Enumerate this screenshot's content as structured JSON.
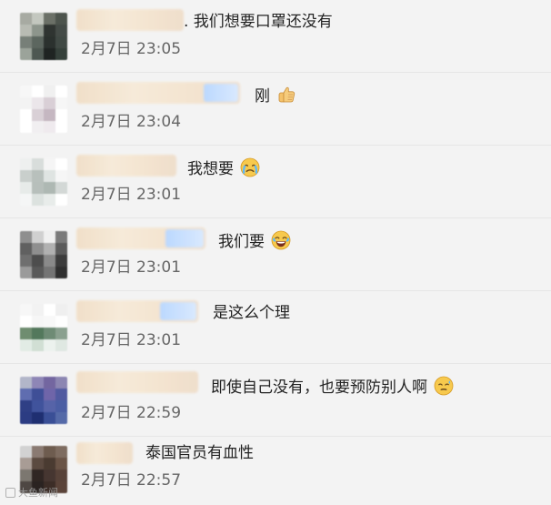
{
  "comments": [
    {
      "text": ". 我们想要口罩还没有",
      "time": "2月7日 23:05",
      "avatar_palette": [
        "#a7aaa2",
        "#c3c7bf",
        "#6b7067",
        "#4d544d",
        "#b8bbb3",
        "#8d958c",
        "#2f3431",
        "#444b47",
        "#777f78",
        "#5c665f",
        "#2b312e",
        "#404944",
        "#9ba39a",
        "#4e5852",
        "#1f2422",
        "#35403a"
      ],
      "emoji": "",
      "name_has_blue": false
    },
    {
      "text": "刚",
      "time": "2月7日 23:04",
      "avatar_palette": [
        "#f7f7f7",
        "#ffffff",
        "#f0f0f0",
        "#ffffff",
        "#f3f3f3",
        "#ebe6ea",
        "#d9cfd6",
        "#f6f6f6",
        "#ffffff",
        "#d9d0d6",
        "#c5b7c1",
        "#ffffff",
        "#ffffff",
        "#f1eff1",
        "#efeaee",
        "#ffffff"
      ],
      "emoji": "thumbs-up-icon",
      "name_has_blue": true
    },
    {
      "text": "我想要",
      "time": "2月7日 23:01",
      "avatar_palette": [
        "#eef0ef",
        "#d8dddb",
        "#f5f5f5",
        "#ffffff",
        "#c9cfcc",
        "#b8c0bc",
        "#dfe4e2",
        "#f6f6f6",
        "#e7ebe9",
        "#b7bfbb",
        "#aeb8b3",
        "#d3d8d6",
        "#f5f6f6",
        "#dce2df",
        "#e8ecea",
        "#ffffff"
      ],
      "emoji": "crying-face-icon",
      "name_has_blue": false
    },
    {
      "text": "我们要",
      "time": "2月7日 23:01",
      "avatar_palette": [
        "#8f8f8f",
        "#d0d0d0",
        "#f0f0f0",
        "#7a7a7a",
        "#606060",
        "#8f8f8f",
        "#b1b1b1",
        "#5b5b5b",
        "#6f6f6f",
        "#4d4d4d",
        "#8a8a8a",
        "#3c3c3c",
        "#9a9a9a",
        "#595959",
        "#747474",
        "#2f2f2f"
      ],
      "emoji": "laughing-face-icon",
      "name_has_blue": true
    },
    {
      "text": "是这么个理",
      "time": "2月7日 23:01",
      "avatar_palette": [
        "#f7f7f7",
        "#f2f2f2",
        "#ffffff",
        "#efefef",
        "#ffffff",
        "#f6f6f6",
        "#f8f8f8",
        "#fefefe",
        "#6f8d70",
        "#53785c",
        "#6e8b75",
        "#8aa08f",
        "#e2ece5",
        "#d1dfd4",
        "#ecf2ee",
        "#dfe8e2"
      ],
      "emoji": "",
      "name_has_blue": true
    },
    {
      "text": "即使自己没有，也要预防别人啊",
      "time": "2月7日 22:59",
      "avatar_palette": [
        "#b2b6c9",
        "#8e86b6",
        "#7366a0",
        "#8c86b2",
        "#5f6db0",
        "#3f4f97",
        "#6f65a9",
        "#515aa0",
        "#2f3f85",
        "#40539c",
        "#5663a8",
        "#4b5ea4",
        "#2c3c83",
        "#1f2f71",
        "#3a4f96",
        "#556aa8"
      ],
      "emoji": "tired-face-icon",
      "name_has_blue": false
    },
    {
      "text": "泰国官员有血性",
      "time": "2月7日 22:57",
      "avatar_palette": [
        "#d2d2d2",
        "#8a7a72",
        "#6e5c4f",
        "#7e6c60",
        "#a89c95",
        "#5b4a40",
        "#4a3b31",
        "#6a5446",
        "#7c7770",
        "#302623",
        "#463631",
        "#574239",
        "#4e4743",
        "#2a2321",
        "#3c2d27",
        "#5a4339"
      ],
      "emoji": "",
      "name_has_blue": false
    }
  ],
  "watermark": {
    "text": "大鱼新闻"
  }
}
